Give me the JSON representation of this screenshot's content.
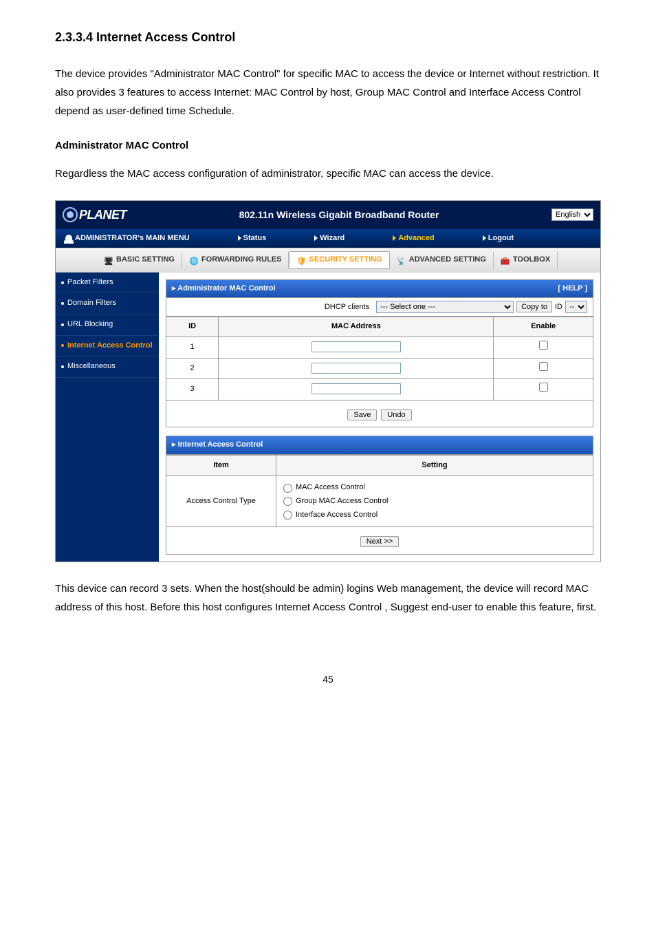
{
  "section_title": "2.3.3.4 Internet Access Control",
  "intro_text": "The device provides \"Administrator MAC Control\" for specific MAC to access the device or Internet without restriction. It also provides 3 features to access Internet: MAC Control by host, Group MAC Control and Interface Access Control depend as user-defined time Schedule.",
  "admin_mac_title": "Administrator MAC Control",
  "admin_mac_text": "Regardless the MAC access configuration of administrator, specific MAC can access the device.",
  "banner_title": "802.11n Wireless Gigabit Broadband Router",
  "language": "English",
  "main_menu_title": "ADMINISTRATOR's MAIN MENU",
  "main_menu": {
    "status": "Status",
    "wizard": "Wizard",
    "advanced": "Advanced",
    "logout": "Logout"
  },
  "sub_menu": {
    "basic": "BASIC SETTING",
    "forwarding": "FORWARDING RULES",
    "security": "SECURITY SETTING",
    "advanced": "ADVANCED SETTING",
    "toolbox": "TOOLBOX"
  },
  "sidebar": {
    "packet_filters": "Packet Filters",
    "domain_filters": "Domain Filters",
    "url_blocking": "URL Blocking",
    "internet_access": "Internet Access Control",
    "miscellaneous": "Miscellaneous"
  },
  "panel1": {
    "title": "Administrator MAC Control",
    "help": "[ HELP ]",
    "dhcp_label": "DHCP clients",
    "dhcp_select": "--- Select one ---",
    "copy_btn": "Copy to",
    "id_label": "ID",
    "id_select": "--",
    "col_id": "ID",
    "col_mac": "MAC Address",
    "col_enable": "Enable",
    "rows": [
      "1",
      "2",
      "3"
    ],
    "save_btn": "Save",
    "undo_btn": "Undo"
  },
  "panel2": {
    "title": "Internet Access Control",
    "col_item": "Item",
    "col_setting": "Setting",
    "item_label": "Access Control Type",
    "opt1": "MAC Access Control",
    "opt2": "Group MAC Access Control",
    "opt3": "Interface Access Control",
    "next_btn": "Next >>"
  },
  "footer_text": "This device can record 3 sets. When the host(should be admin) logins Web management, the device will record MAC address of this host. Before this host configures Internet Access Control , Suggest end-user to enable this feature, first.",
  "page_number": "45"
}
